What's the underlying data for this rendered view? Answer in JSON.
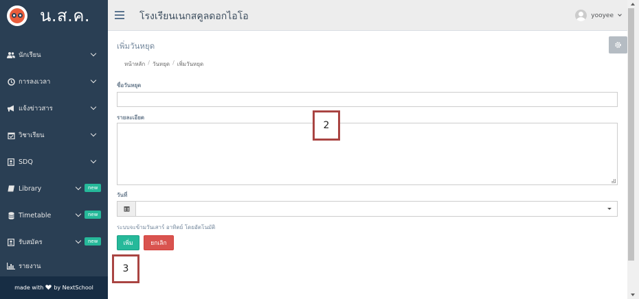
{
  "brand": {
    "name": "น.ส.ค."
  },
  "sidebar": {
    "items": [
      {
        "label": "นักเรียน",
        "icon": "users-icon",
        "badge": ""
      },
      {
        "label": "การลงเวลา",
        "icon": "clock-icon",
        "badge": ""
      },
      {
        "label": "แจ้งข่าวสาร",
        "icon": "bullhorn-icon",
        "badge": ""
      },
      {
        "label": "วิชาเรียน",
        "icon": "calendar-check-icon",
        "badge": ""
      },
      {
        "label": "SDQ",
        "icon": "portrait-icon",
        "badge": ""
      },
      {
        "label": "Library",
        "icon": "book-icon",
        "badge": "new"
      },
      {
        "label": "Timetable",
        "icon": "database-icon",
        "badge": "new"
      },
      {
        "label": "รับสมัคร",
        "icon": "portrait-icon",
        "badge": "new"
      },
      {
        "label": "รายงาน",
        "icon": "bar-chart-icon",
        "badge": ""
      }
    ],
    "footer": {
      "prefix": "made with",
      "suffix": "by NextSchool"
    }
  },
  "topbar": {
    "school_name": "โรงเรียนเนกสคูลดอกไอโอ",
    "username": "yooyee"
  },
  "page": {
    "title": "เพิ่มวันหยุด",
    "breadcrumb": {
      "home": "หน้าหลัก",
      "section": "วันหยุด",
      "current": "เพิ่มวันหยุด"
    }
  },
  "form": {
    "holiday_name_label": "ชื่อวันหยุด",
    "holiday_name_value": "",
    "detail_label": "รายละเอียด",
    "detail_value": "",
    "date_label": "วันที่",
    "date_value": "",
    "helper_text": "ระบบจะข้ามวันเสาร์ อาทิตย์ โดยอัตโนมัติ",
    "add_label": "เพิ่ม",
    "cancel_label": "ยกเลิก"
  },
  "annotations": {
    "box2": "2",
    "box3": "3"
  },
  "colors": {
    "sidebar_bg": "#2a3f54",
    "footer_bg": "#172d44",
    "success": "#26b99a",
    "danger": "#d9534f",
    "annotation_border": "#a94442"
  }
}
